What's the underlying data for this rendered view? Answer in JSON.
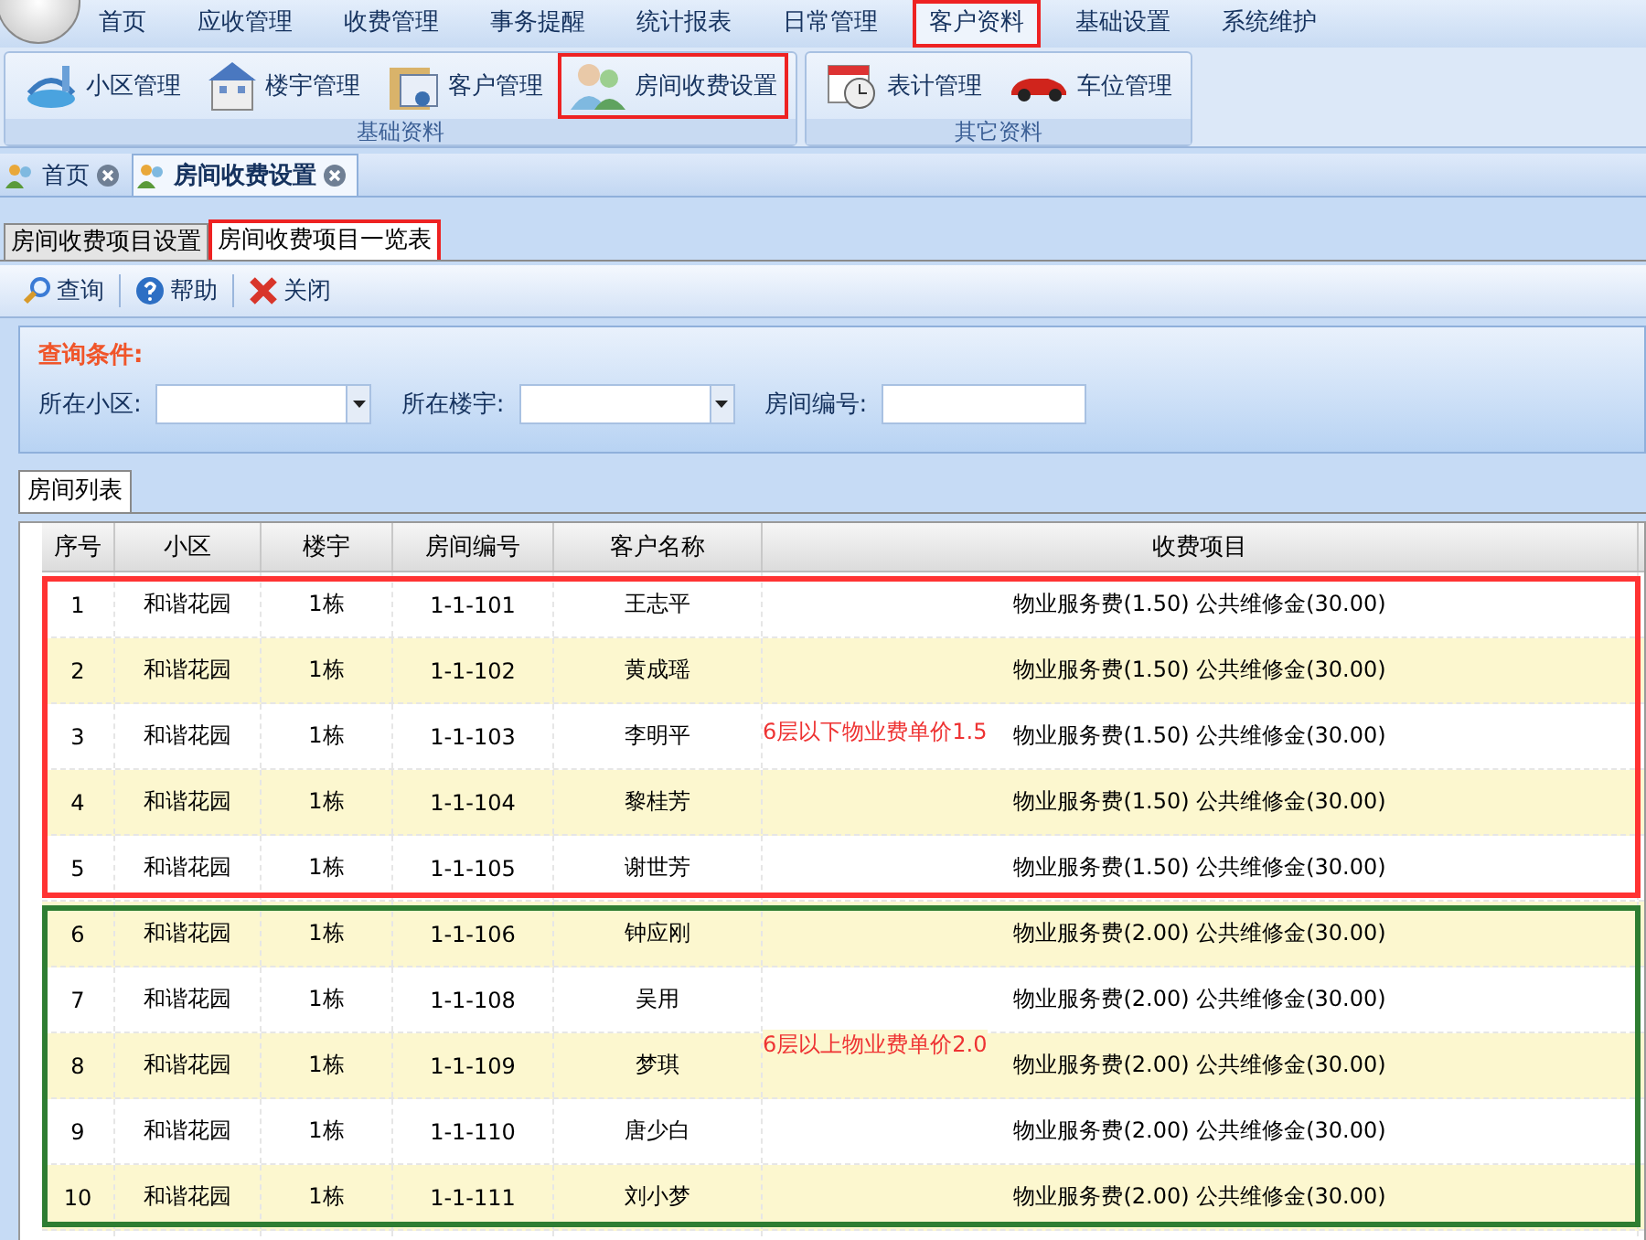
{
  "menu": [
    {
      "label": "首页",
      "selected": false
    },
    {
      "label": "应收管理",
      "selected": false
    },
    {
      "label": "收费管理",
      "selected": false
    },
    {
      "label": "事务提醒",
      "selected": false
    },
    {
      "label": "统计报表",
      "selected": false
    },
    {
      "label": "日常管理",
      "selected": false
    },
    {
      "label": "客户资料",
      "selected": true
    },
    {
      "label": "基础设置",
      "selected": false
    },
    {
      "label": "系统维护",
      "selected": false
    }
  ],
  "ribbon_groups": [
    {
      "title": "基础资料",
      "buttons": [
        {
          "label": "小区管理",
          "highlighted": false
        },
        {
          "label": "楼宇管理",
          "highlighted": false
        },
        {
          "label": "客户管理",
          "highlighted": false
        },
        {
          "label": "房间收费设置",
          "highlighted": true
        }
      ]
    },
    {
      "title": "其它资料",
      "buttons": [
        {
          "label": "表计管理",
          "highlighted": false
        },
        {
          "label": "车位管理",
          "highlighted": false
        }
      ]
    }
  ],
  "doc_tabs": [
    {
      "label": "首页",
      "selected": false
    },
    {
      "label": "房间收费设置",
      "selected": true
    }
  ],
  "sub_tabs": [
    {
      "label": "房间收费项目设置",
      "selected": false
    },
    {
      "label": "房间收费项目一览表",
      "selected": true
    }
  ],
  "toolbar": [
    "查询",
    "帮助",
    "关闭"
  ],
  "query": {
    "title": "查询条件:",
    "fields": [
      {
        "label": "所在小区:",
        "kind": "select"
      },
      {
        "label": "所在楼宇:",
        "kind": "select"
      },
      {
        "label": "房间编号:",
        "kind": "text"
      }
    ]
  },
  "list_tab": "房间列表",
  "table": {
    "columns": [
      "序号",
      "小区",
      "楼宇",
      "房间编号",
      "客户名称",
      "收费项目"
    ],
    "groups": [
      {
        "color": "#ff3333",
        "note": "6层以下物业费单价1.5",
        "rows": [
          [
            "1",
            "和谐花园",
            "1栋",
            "1-1-101",
            "王志平",
            "物业服务费(1.50) 公共维修金(30.00)"
          ],
          [
            "2",
            "和谐花园",
            "1栋",
            "1-1-102",
            "黄成瑶",
            "物业服务费(1.50) 公共维修金(30.00)"
          ],
          [
            "3",
            "和谐花园",
            "1栋",
            "1-1-103",
            "李明平",
            "物业服务费(1.50) 公共维修金(30.00)"
          ],
          [
            "4",
            "和谐花园",
            "1栋",
            "1-1-104",
            "黎桂芳",
            "物业服务费(1.50) 公共维修金(30.00)"
          ],
          [
            "5",
            "和谐花园",
            "1栋",
            "1-1-105",
            "谢世芳",
            "物业服务费(1.50) 公共维修金(30.00)"
          ]
        ]
      },
      {
        "color": "#2e7d32",
        "note": "6层以上物业费单价2.0",
        "rows": [
          [
            "6",
            "和谐花园",
            "1栋",
            "1-1-106",
            "钟应刚",
            "物业服务费(2.00) 公共维修金(30.00)"
          ],
          [
            "7",
            "和谐花园",
            "1栋",
            "1-1-108",
            "吴用",
            "物业服务费(2.00) 公共维修金(30.00)"
          ],
          [
            "8",
            "和谐花园",
            "1栋",
            "1-1-109",
            "梦琪",
            "物业服务费(2.00) 公共维修金(30.00)"
          ],
          [
            "9",
            "和谐花园",
            "1栋",
            "1-1-110",
            "唐少白",
            "物业服务费(2.00) 公共维修金(30.00)"
          ],
          [
            "10",
            "和谐花园",
            "1栋",
            "1-1-111",
            "刘小梦",
            "物业服务费(2.00) 公共维修金(30.00)"
          ]
        ]
      }
    ]
  }
}
